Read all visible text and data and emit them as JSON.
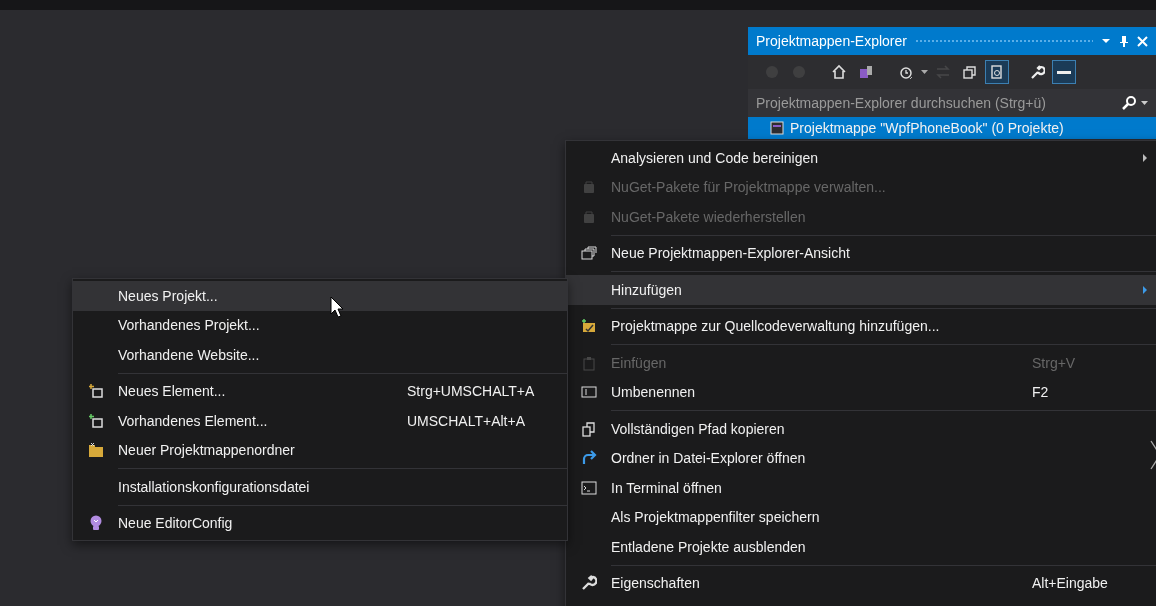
{
  "solution_explorer": {
    "title": "Projektmappen-Explorer",
    "toolbar": [
      {
        "selected": false,
        "disabled": true
      },
      {
        "selected": false,
        "disabled": true
      },
      {
        "selected": false,
        "disabled": false
      },
      {
        "selected": false,
        "disabled": false
      },
      {
        "selected": false,
        "disabled": false
      },
      {
        "selected": false,
        "disabled": true
      },
      {
        "selected": false,
        "disabled": false
      },
      {
        "selected": true,
        "disabled": false
      },
      {
        "selected": false,
        "disabled": false
      },
      {
        "selected": true,
        "disabled": false
      }
    ],
    "search": {
      "placeholder": "Projektmappen-Explorer durchsuchen (Strg+ü)"
    },
    "tree": [
      {
        "label": "Projektmappe \"WpfPhoneBook\" (0 Projekte)",
        "selected": true
      }
    ]
  },
  "context_menu": [
    {
      "kind": "item",
      "label": "Analysieren und Code bereinigen",
      "disabled": false,
      "selected": false,
      "submenu": true
    },
    {
      "kind": "item",
      "label": "NuGet-Pakete für Projektmappe verwalten...",
      "disabled": true,
      "selected": false,
      "submenu": false
    },
    {
      "kind": "item",
      "label": "NuGet-Pakete wiederherstellen",
      "disabled": true,
      "selected": false,
      "submenu": false
    },
    {
      "kind": "separator"
    },
    {
      "kind": "item",
      "label": "Neue Projektmappen-Explorer-Ansicht",
      "disabled": false,
      "selected": false,
      "submenu": false
    },
    {
      "kind": "separator"
    },
    {
      "kind": "item",
      "label": "Hinzufügen",
      "disabled": false,
      "selected": true,
      "submenu": true
    },
    {
      "kind": "separator"
    },
    {
      "kind": "item",
      "label": "Projektmappe zur Quellcodeverwaltung hinzufügen...",
      "disabled": false,
      "selected": false,
      "submenu": false
    },
    {
      "kind": "separator"
    },
    {
      "kind": "item",
      "label": "Einfügen",
      "shortcut": "Strg+V",
      "disabled": true,
      "selected": false,
      "submenu": false
    },
    {
      "kind": "item",
      "label": "Umbenennen",
      "shortcut": "F2",
      "disabled": false,
      "selected": false,
      "submenu": false
    },
    {
      "kind": "separator"
    },
    {
      "kind": "item",
      "label": "Vollständigen Pfad kopieren",
      "disabled": false,
      "selected": false,
      "submenu": false
    },
    {
      "kind": "item",
      "label": "Ordner in Datei-Explorer öffnen",
      "disabled": false,
      "selected": false,
      "submenu": false
    },
    {
      "kind": "item",
      "label": "In Terminal öffnen",
      "disabled": false,
      "selected": false,
      "submenu": false
    },
    {
      "kind": "item",
      "label": "Als Projektmappenfilter speichern",
      "disabled": false,
      "selected": false,
      "submenu": false
    },
    {
      "kind": "item",
      "label": "Entladene Projekte ausblenden",
      "disabled": false,
      "selected": false,
      "submenu": false
    },
    {
      "kind": "separator"
    },
    {
      "kind": "item",
      "label": "Eigenschaften",
      "shortcut": "Alt+Eingabe",
      "disabled": false,
      "selected": false,
      "submenu": false
    }
  ],
  "add_submenu": [
    {
      "kind": "item",
      "label": "Neues Projekt...",
      "selected": true
    },
    {
      "kind": "item",
      "label": "Vorhandenes Projekt...",
      "selected": false
    },
    {
      "kind": "item",
      "label": "Vorhandene Website...",
      "selected": false
    },
    {
      "kind": "separator"
    },
    {
      "kind": "item",
      "label": "Neues Element...",
      "shortcut": "Strg+UMSCHALT+A",
      "selected": false
    },
    {
      "kind": "item",
      "label": "Vorhandenes Element...",
      "shortcut": "UMSCHALT+Alt+A",
      "selected": false
    },
    {
      "kind": "item",
      "label": "Neuer Projektmappenordner",
      "selected": false
    },
    {
      "kind": "separator"
    },
    {
      "kind": "item",
      "label": "Installationskonfigurationsdatei",
      "selected": false
    },
    {
      "kind": "separator"
    },
    {
      "kind": "item",
      "label": "Neue EditorConfig",
      "selected": false
    }
  ]
}
